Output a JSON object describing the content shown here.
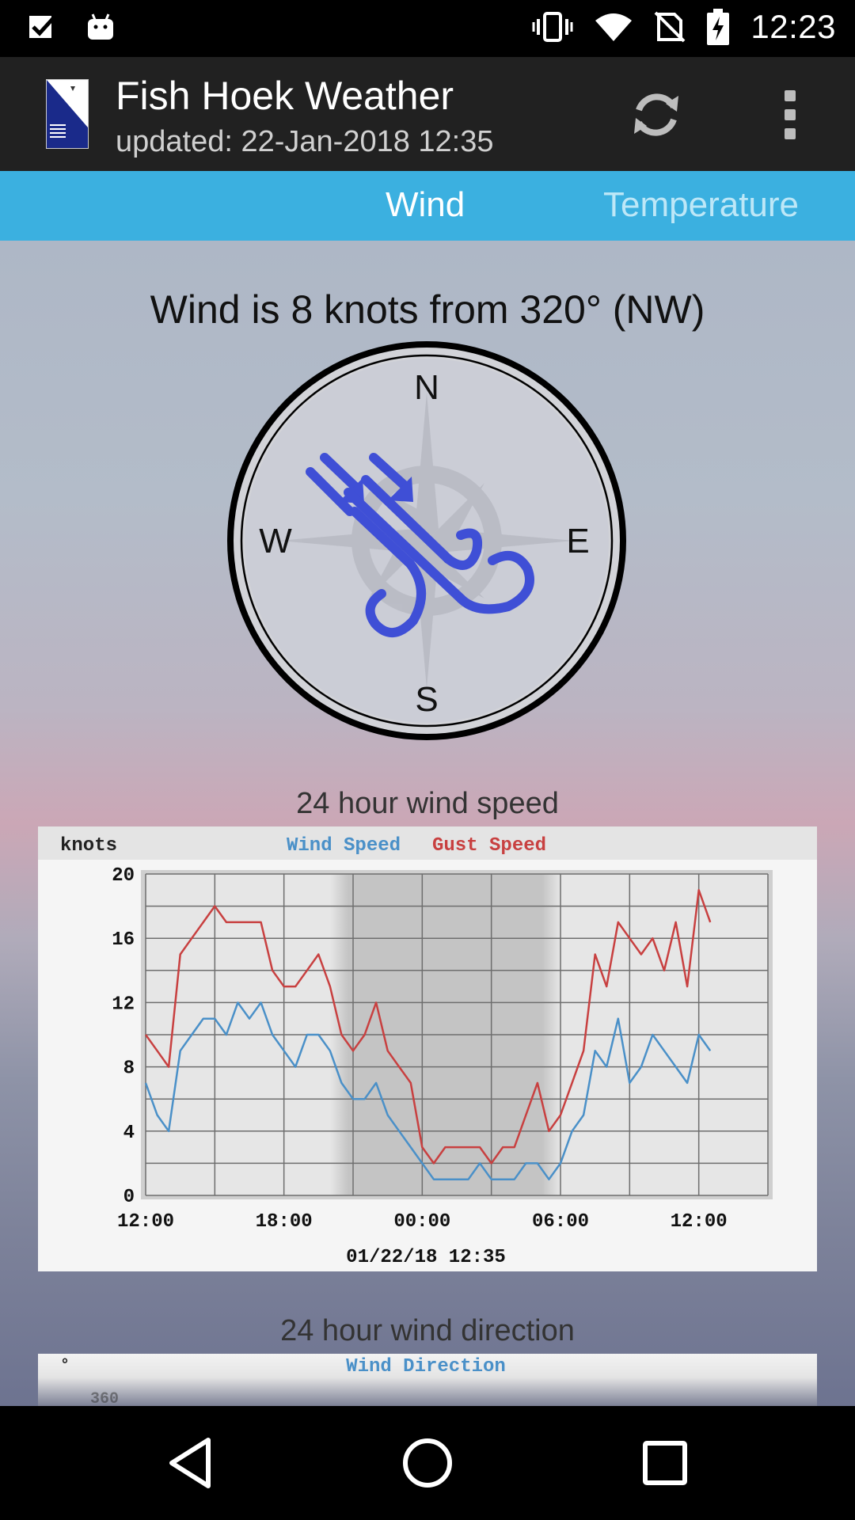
{
  "status_bar": {
    "time": "12:23",
    "icons": [
      "checkbox-notification-icon",
      "android-icon",
      "vibrate-icon",
      "wifi-icon",
      "no-sim-icon",
      "battery-charging-icon"
    ]
  },
  "app_bar": {
    "title": "Fish Hoek Weather",
    "subtitle": "updated: 22-Jan-2018 12:35",
    "actions": [
      "refresh-icon",
      "more-vert-icon"
    ]
  },
  "tabs": [
    {
      "label": "Wind",
      "selected": true
    },
    {
      "label": "Temperature",
      "selected": false
    }
  ],
  "wind": {
    "headline": "Wind is 8 knots from 320° (NW)",
    "speed_knots": 8,
    "direction_deg": 320,
    "compass": {
      "n": "N",
      "e": "E",
      "s": "S",
      "w": "W"
    },
    "icon": "wind-icon",
    "icon_color": "#3f4fd6"
  },
  "speed_chart": {
    "title": "24 hour wind speed",
    "ylabel": "knots",
    "legend": [
      {
        "name": "Wind Speed",
        "color": "#4a90c8"
      },
      {
        "name": "Gust Speed",
        "color": "#c84040"
      }
    ],
    "xticks": [
      "12:00",
      "18:00",
      "00:00",
      "06:00",
      "12:00"
    ],
    "yticks": [
      "0",
      "4",
      "8",
      "12",
      "16",
      "20"
    ],
    "timestamp": "01/22/18 12:35"
  },
  "direction_chart": {
    "title": "24 hour wind direction",
    "legend": "Wind Direction",
    "unit": "°",
    "first_tick": "360"
  },
  "chart_data": {
    "type": "line",
    "title": "",
    "xlabel": "",
    "ylabel": "knots",
    "ylim": [
      0,
      20
    ],
    "xticks": [
      "12:00",
      "18:00",
      "00:00",
      "06:00",
      "12:00"
    ],
    "x_hours": [
      0,
      0.5,
      1,
      1.5,
      2,
      2.5,
      3,
      3.5,
      4,
      4.5,
      5,
      5.5,
      6,
      6.5,
      7,
      7.5,
      8,
      8.5,
      9,
      9.5,
      10,
      10.5,
      11,
      11.5,
      12,
      12.5,
      13,
      13.5,
      14,
      14.5,
      15,
      15.5,
      16,
      16.5,
      17,
      17.5,
      18,
      18.5,
      19,
      19.5,
      20,
      20.5,
      21,
      21.5,
      22,
      22.5,
      23,
      23.5,
      24,
      24.5
    ],
    "series": [
      {
        "name": "Wind Speed",
        "color": "#4a90c8",
        "values": [
          7,
          5,
          4,
          9,
          10,
          11,
          11,
          10,
          12,
          11,
          12,
          10,
          9,
          8,
          10,
          10,
          9,
          7,
          6,
          6,
          7,
          5,
          4,
          3,
          2,
          1,
          1,
          1,
          1,
          2,
          1,
          1,
          1,
          2,
          2,
          1,
          2,
          4,
          5,
          9,
          8,
          11,
          7,
          8,
          10,
          9,
          8,
          7,
          10,
          9
        ]
      },
      {
        "name": "Gust Speed",
        "color": "#c84040",
        "values": [
          10,
          9,
          8,
          15,
          16,
          17,
          18,
          17,
          17,
          17,
          17,
          14,
          13,
          13,
          14,
          15,
          13,
          10,
          9,
          10,
          12,
          9,
          8,
          7,
          3,
          2,
          3,
          3,
          3,
          3,
          2,
          3,
          3,
          5,
          7,
          4,
          5,
          7,
          9,
          15,
          13,
          17,
          16,
          15,
          16,
          14,
          17,
          13,
          19,
          17
        ]
      }
    ],
    "night_shading": {
      "from_hour": 8,
      "to_hour": 18
    }
  }
}
